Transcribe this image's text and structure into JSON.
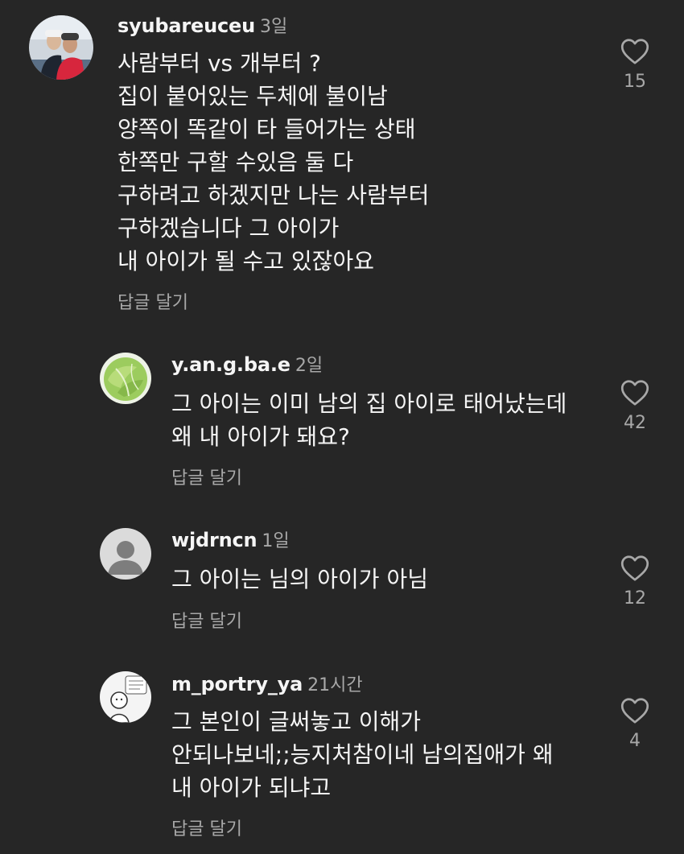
{
  "comments": [
    {
      "username": "syubareuceu",
      "time": "3일",
      "lines": [
        "사람부터 vs  개부터 ?",
        "집이 붙어있는 두체에 불이남",
        "양쪽이 똑같이 타 들어가는 상태",
        "한쪽만 구할 수있음 둘 다",
        "구하려고 하겠지만 나는 사람부터",
        "구하겠습니다 그 아이가",
        "내 아이가 될 수고 있잖아요"
      ],
      "reply_label": "답글 달기",
      "likes": "15"
    },
    {
      "username": "y.an.g.ba.e",
      "time": "2일",
      "lines": [
        "그 아이는 이미 남의 집 아이로 태어났는데",
        "왜 내 아이가 돼요?"
      ],
      "reply_label": "답글 달기",
      "likes": "42"
    },
    {
      "username": "wjdrncn",
      "time": "1일",
      "lines": [
        "그 아이는 님의 아이가 아님"
      ],
      "reply_label": "답글 달기",
      "likes": "12"
    },
    {
      "username": "m_portry_ya",
      "time": "21시간",
      "lines": [
        "그 본인이 글써놓고 이해가",
        "안되나보네;;능지처참이네 남의집애가 왜",
        "내 아이가 되냐고"
      ],
      "reply_label": "답글 달기",
      "likes": "4"
    }
  ],
  "colors": {
    "background": "#262626",
    "text": "#f5f5f5",
    "secondary": "#a8a8a8"
  },
  "icons": {
    "like": "heart-outline-icon",
    "default_avatar": "default-avatar-icon"
  }
}
